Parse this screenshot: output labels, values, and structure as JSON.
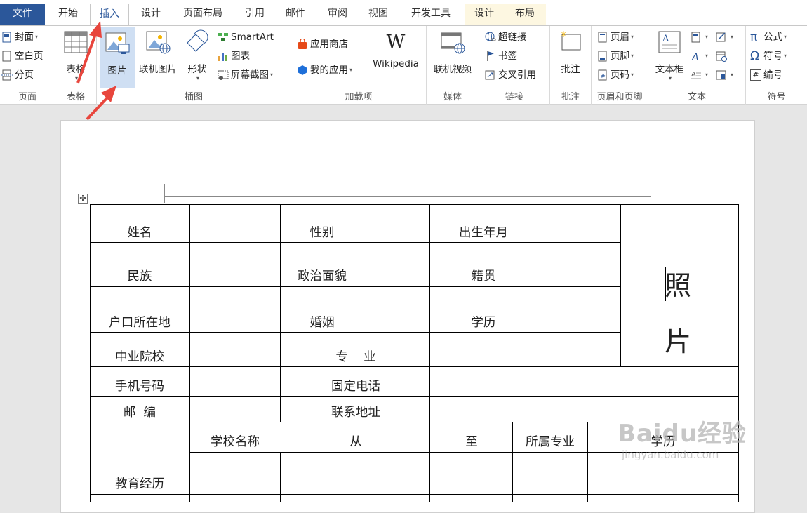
{
  "tabs": [
    {
      "label": "文件"
    },
    {
      "label": "开始"
    },
    {
      "label": "插入"
    },
    {
      "label": "设计"
    },
    {
      "label": "页面布局"
    },
    {
      "label": "引用"
    },
    {
      "label": "邮件"
    },
    {
      "label": "审阅"
    },
    {
      "label": "视图"
    },
    {
      "label": "开发工具"
    },
    {
      "label": "设计"
    },
    {
      "label": "布局"
    }
  ],
  "ribbon": {
    "pages": {
      "label": "页面",
      "cover": "封面",
      "blank": "空白页",
      "break": "分页"
    },
    "table": {
      "label": "表格",
      "button": "表格"
    },
    "illustrations": {
      "label": "插图",
      "picture": "图片",
      "online_picture": "联机图片",
      "shapes": "形状",
      "smartart": "SmartArt",
      "chart": "图表",
      "screenshot": "屏幕截图"
    },
    "addins": {
      "label": "加载项",
      "store": "应用商店",
      "my_apps": "我的应用",
      "wikipedia": "Wikipedia",
      "wiki_logo": "W"
    },
    "media": {
      "label": "媒体",
      "online_video": "联机视频"
    },
    "links": {
      "label": "链接",
      "hyperlink": "超链接",
      "bookmark": "书签",
      "cross_ref": "交叉引用"
    },
    "comments": {
      "label": "批注",
      "comment": "批注"
    },
    "header_footer": {
      "label": "页眉和页脚",
      "header": "页眉",
      "footer": "页脚",
      "page_number": "页码"
    },
    "text": {
      "label": "文本",
      "textbox": "文本框"
    },
    "symbols": {
      "label": "符号",
      "equation": "公式",
      "symbol": "符号",
      "number": "编号",
      "pi": "π",
      "omega": "Ω",
      "hash": "#"
    }
  },
  "table": {
    "row1": {
      "name": "姓名",
      "gender": "性别",
      "birth": "出生年月"
    },
    "row2": {
      "ethnic": "民族",
      "political": "政治面貌",
      "native": "籍贯"
    },
    "row3": {
      "hukou": "户口所在地",
      "marriage": "婚姻",
      "education": "学历"
    },
    "row4": {
      "college": "中业院校",
      "major": "专    业"
    },
    "row5": {
      "mobile": "手机号码",
      "phone": "固定电话"
    },
    "row6": {
      "postcode": "邮  编",
      "address": "联系地址"
    },
    "row7": {
      "school": "学校名称",
      "from": "从",
      "to": "至",
      "field": "所属专业",
      "degree": "学历"
    },
    "edu": "教育经历",
    "photo1": "照",
    "photo2": "片"
  },
  "watermark": {
    "text": "Baidu经验",
    "url": "jingyan.baidu.com"
  },
  "colors": {
    "file_tab": "#2b579a",
    "arrow": "#e8463d",
    "picture_highlight": "#cfdff3"
  }
}
